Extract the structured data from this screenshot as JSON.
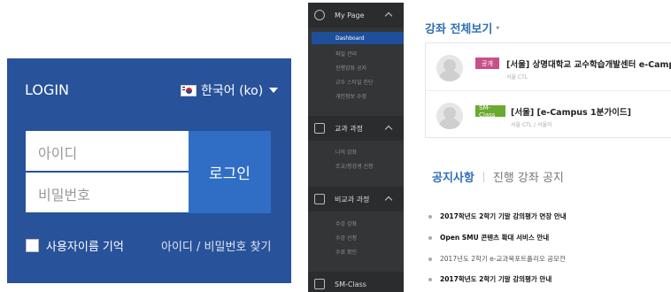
{
  "login": {
    "title": "LOGIN",
    "language": "한국어 (ko)",
    "id_placeholder": "아이디",
    "pw_placeholder": "비밀번호",
    "login_button": "로그인",
    "remember_label": "사용자이름 기억",
    "find_link": "아이디 / 비밀번호 찾기"
  },
  "sidebar": {
    "sections": [
      {
        "label": "My Page",
        "icon": "user-icon",
        "items": [
          "Dashboard",
          "파일 관리",
          "진행강좌 공지",
          "교수 스타일 진단",
          "개인정보 수정"
        ]
      },
      {
        "label": "교과 과정",
        "icon": "book-icon",
        "items": [
          "나의 강좌",
          "조교/청강생 신청"
        ]
      },
      {
        "label": "비교과 과정",
        "icon": "tablet-icon",
        "items": [
          "수강 강좌",
          "수강 신청",
          "수료 확인"
        ]
      },
      {
        "label": "SM-Class",
        "icon": "book-open-icon",
        "items": []
      }
    ],
    "active_item": "Dashboard"
  },
  "courses": {
    "title": "강좌 전체보기",
    "dropdown": "▾",
    "items": [
      {
        "badge": "공개",
        "title": "[서울] 상명대학교 교수학습개발센터 e-Campus",
        "sub": "서울 CTL"
      },
      {
        "badge": "SM-Class",
        "title": "[서울] [e-Campus 1분가이드]",
        "sub": "서울 CTL / 서울이"
      }
    ]
  },
  "notices": {
    "tab_active": "공지사항",
    "tab_other": "진행 강좌 공지",
    "items": [
      {
        "text": "2017학년도 2학기 기말 강의평가 연장 안내",
        "style": "bold"
      },
      {
        "text": "Open SMU 콘텐츠 확대 서비스 안내",
        "style": "bold"
      },
      {
        "text": "2017년도 2학기 e-교과목포트폴리오 공모전",
        "style": "light"
      },
      {
        "text": "2017학년도 2학기 기말 강의평가 안내",
        "style": "bold"
      }
    ]
  },
  "colors": {
    "login_bg": "#28529a",
    "login_button": "#2f6ec4",
    "sidebar_bg": "#333537",
    "accent": "#2f6fb2",
    "badge_public": "#c94f8a",
    "badge_smclass": "#6aaa2f"
  }
}
